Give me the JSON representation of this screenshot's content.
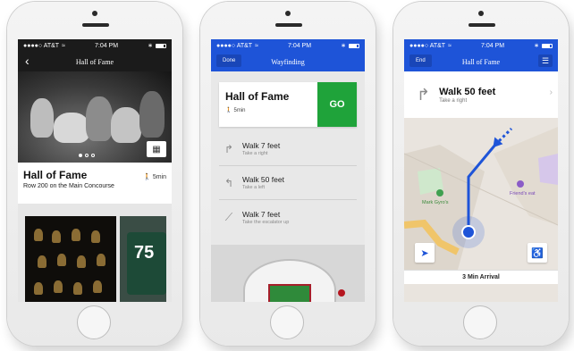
{
  "status_bar": {
    "carrier": "●●●●○ AT&T",
    "wifi": "≈",
    "time": "7:04 PM",
    "bluetooth": "∗"
  },
  "phone1": {
    "nav": {
      "back_icon": "chevron-left-icon",
      "title": "Hall of Fame"
    },
    "carousel": {
      "pages": 3,
      "active_page": 1,
      "map_icon": "map-icon"
    },
    "info": {
      "title": "Hall of Fame",
      "subtitle": "Row 200 on the Main Concourse",
      "walk_time": "5min"
    },
    "thumbnail_jersey_number": "75"
  },
  "phone2": {
    "nav": {
      "done_label": "Done",
      "title": "Wayfinding"
    },
    "destination": {
      "title": "Hall of Fame",
      "walk_time": "5min",
      "go_label": "GO"
    },
    "steps": [
      {
        "icon": "turn-right-icon",
        "glyph": "↱",
        "main": "Walk 7 feet",
        "sub": "Take a right"
      },
      {
        "icon": "turn-left-icon",
        "glyph": "↰",
        "main": "Walk 50 feet",
        "sub": "Take a left"
      },
      {
        "icon": "escalator-icon",
        "glyph": "⟋",
        "main": "Walk 7 feet",
        "sub": "Take the escalator up"
      }
    ]
  },
  "phone3": {
    "nav": {
      "end_label": "End",
      "title": "Hall of Fame",
      "list_icon": "list-icon"
    },
    "instruction": {
      "main": "Walk 50 feet",
      "sub": "Take a right"
    },
    "map": {
      "poi_left": "Mark Gyro's",
      "poi_right": "Friend's eat",
      "route_color": "#1e54d8"
    },
    "bottom_label": "3 Min Arrival"
  },
  "colors": {
    "accent": "#1e54d8",
    "go": "#1fa33a"
  }
}
